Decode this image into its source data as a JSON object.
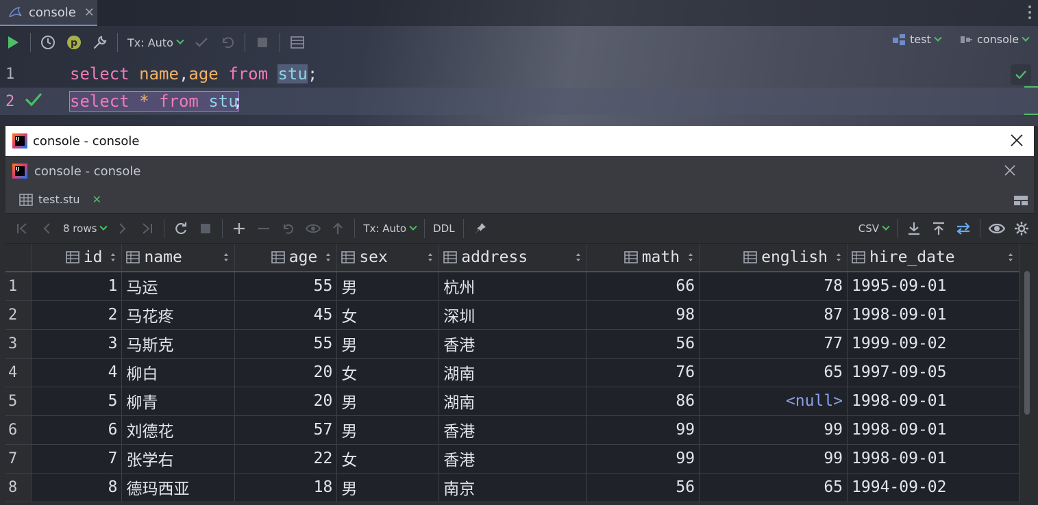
{
  "editor": {
    "tab_label": "console",
    "toolbar": {
      "tx_label": "Tx: Auto",
      "datasource_label": "test",
      "session_label": "console"
    },
    "lines": [
      {
        "num": "1",
        "tokens": [
          "select",
          " ",
          "name",
          ",",
          "age",
          " ",
          "from",
          " ",
          "stu",
          ";"
        ]
      },
      {
        "num": "2",
        "tokens": [
          "select",
          " ",
          "*",
          " ",
          "from",
          " ",
          "stu",
          ";"
        ]
      }
    ]
  },
  "result_window": {
    "title": "console - console",
    "subtitle": "console - console",
    "file_tab": "test.stu",
    "toolbar": {
      "rows_label": "8 rows",
      "tx_label": "Tx: Auto",
      "ddl_label": "DDL",
      "export_label": "CSV"
    },
    "columns": [
      "id",
      "name",
      "age",
      "sex",
      "address",
      "math",
      "english",
      "hire_date"
    ],
    "rows": [
      {
        "n": "1",
        "id": "1",
        "name": "马运",
        "age": "55",
        "sex": "男",
        "address": "杭州",
        "math": "66",
        "english": "78",
        "hire_date": "1995-09-01"
      },
      {
        "n": "2",
        "id": "2",
        "name": "马花疼",
        "age": "45",
        "sex": "女",
        "address": "深圳",
        "math": "98",
        "english": "87",
        "hire_date": "1998-09-01"
      },
      {
        "n": "3",
        "id": "3",
        "name": "马斯克",
        "age": "55",
        "sex": "男",
        "address": "香港",
        "math": "56",
        "english": "77",
        "hire_date": "1999-09-02"
      },
      {
        "n": "4",
        "id": "4",
        "name": "柳白",
        "age": "20",
        "sex": "女",
        "address": "湖南",
        "math": "76",
        "english": "65",
        "hire_date": "1997-09-05"
      },
      {
        "n": "5",
        "id": "5",
        "name": "柳青",
        "age": "20",
        "sex": "男",
        "address": "湖南",
        "math": "86",
        "english": "<null>",
        "hire_date": "1998-09-01"
      },
      {
        "n": "6",
        "id": "6",
        "name": "刘德花",
        "age": "57",
        "sex": "男",
        "address": "香港",
        "math": "99",
        "english": "99",
        "hire_date": "1998-09-01"
      },
      {
        "n": "7",
        "id": "7",
        "name": "张学右",
        "age": "22",
        "sex": "女",
        "address": "香港",
        "math": "99",
        "english": "99",
        "hire_date": "1998-09-01"
      },
      {
        "n": "8",
        "id": "8",
        "name": "德玛西亚",
        "age": "18",
        "sex": "男",
        "address": "南京",
        "math": "56",
        "english": "65",
        "hire_date": "1994-09-02"
      }
    ]
  }
}
